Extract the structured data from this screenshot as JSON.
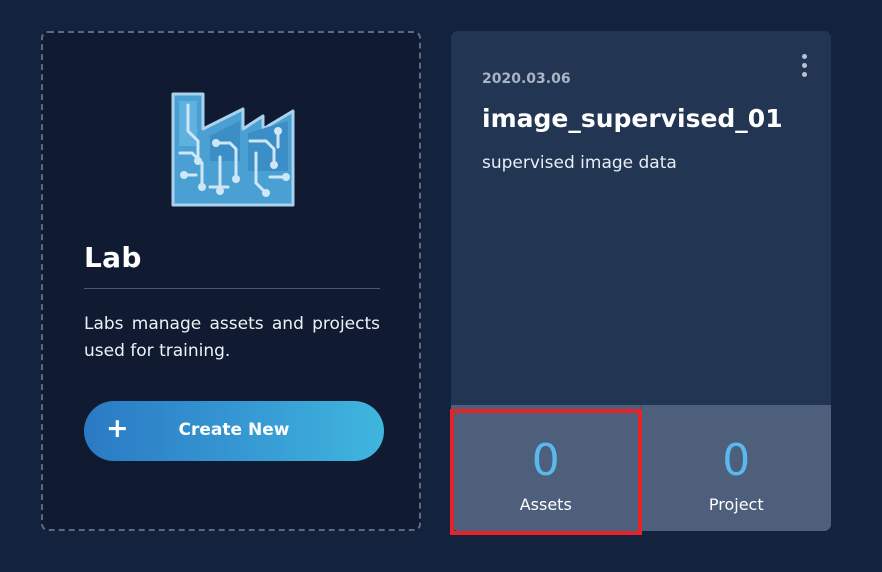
{
  "lab": {
    "icon": "factory-circuit-icon",
    "title": "Lab",
    "description": "Labs manage assets and projects used for training.",
    "create_plus": "+",
    "create_label": "Create New"
  },
  "dataset": {
    "date": "2020.03.06",
    "name": "image_supervised_01",
    "description": "supervised image data",
    "menu_icon": "more-vertical-icon",
    "stats": [
      {
        "value": "0",
        "label": "Assets"
      },
      {
        "value": "0",
        "label": "Project"
      }
    ]
  },
  "colors": {
    "background": "#13223d",
    "lab_card": "#101b32",
    "data_card": "#223552",
    "accent": "#5bb8ee",
    "highlight": "#e3242b"
  }
}
